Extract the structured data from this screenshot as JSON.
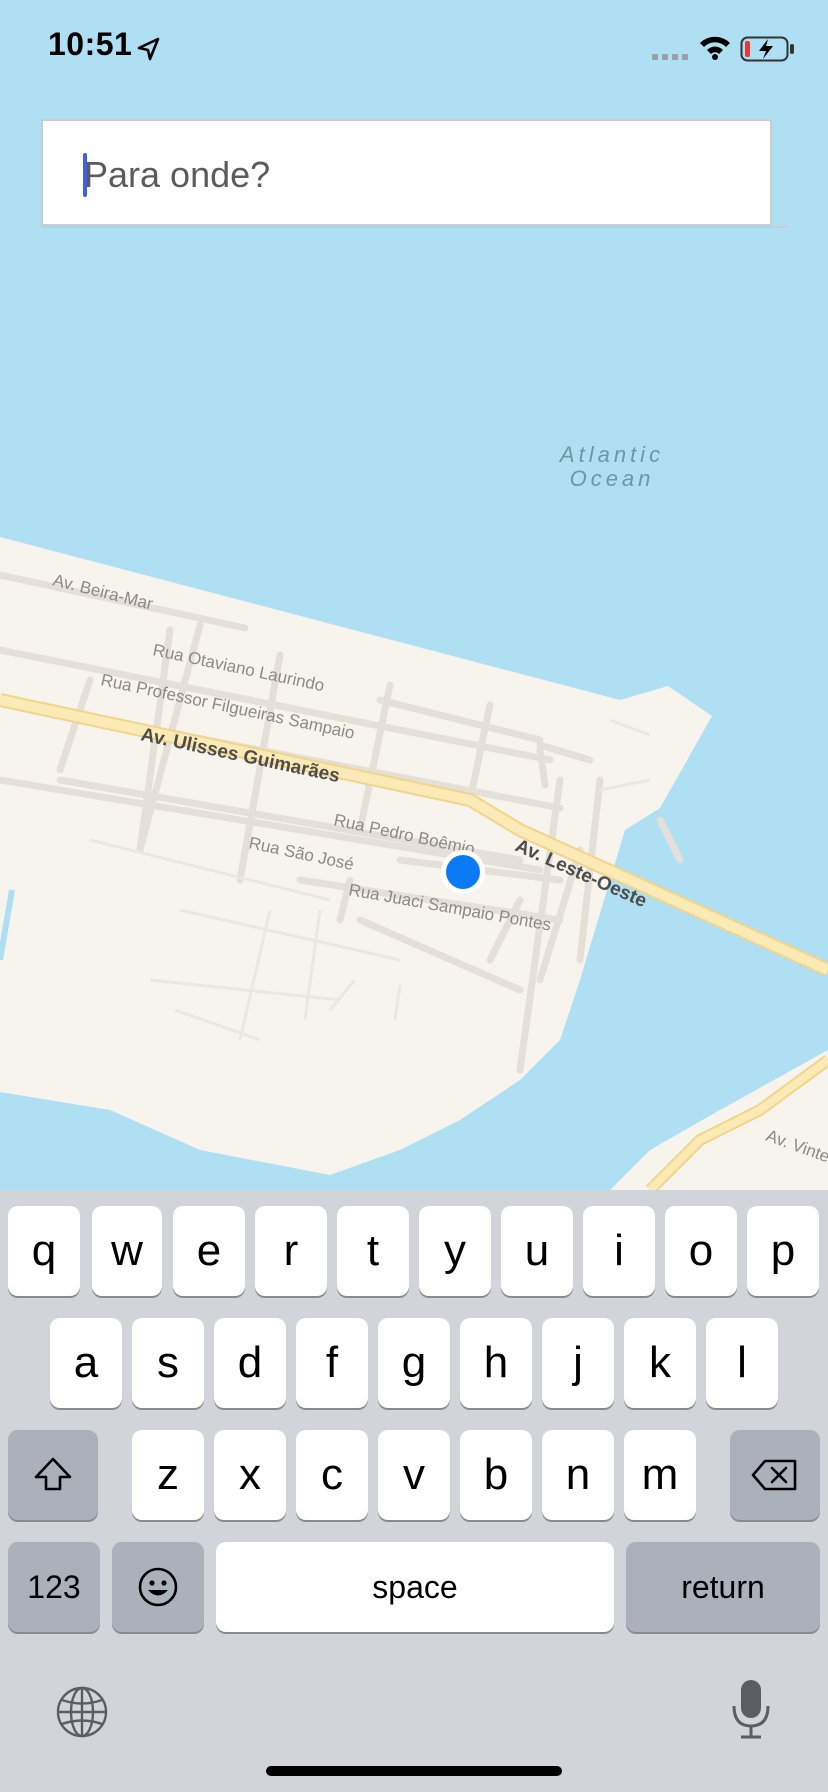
{
  "status_bar": {
    "time": "10:51",
    "icons": [
      "location-arrow-icon",
      "cellular-signal-icon",
      "wifi-icon",
      "battery-charging-icon"
    ]
  },
  "search": {
    "placeholder": "Para onde?",
    "value": ""
  },
  "map": {
    "ocean_label_line1": "Atlantic",
    "ocean_label_line2": "Ocean",
    "streets": {
      "beira_mar": "Av. Beira-Mar",
      "otaviano": "Rua Otaviano Laurindo",
      "filgueiras": "Rua Professor Filgueiras Sampaio",
      "ulisses": "Av. Ulisses Guimarães",
      "pedro": "Rua Pedro Boêmio",
      "sao_jose": "Rua São José",
      "leste_oeste": "Av. Leste-Oeste",
      "juaci": "Rua Juaci Sampaio Pontes",
      "vinte": "Av. Vinte"
    },
    "colors": {
      "water": "#aedff2",
      "land": "#f7f4ee",
      "road": "#e5e1da",
      "highway": "#fbeab5",
      "user_dot": "#0a7bf5"
    }
  },
  "keyboard": {
    "row1": [
      "q",
      "w",
      "e",
      "r",
      "t",
      "y",
      "u",
      "i",
      "o",
      "p"
    ],
    "row2": [
      "a",
      "s",
      "d",
      "f",
      "g",
      "h",
      "j",
      "k",
      "l"
    ],
    "row3": [
      "z",
      "x",
      "c",
      "v",
      "b",
      "n",
      "m"
    ],
    "numbers_label": "123",
    "space_label": "space",
    "return_label": "return",
    "icons": [
      "shift-icon",
      "delete-icon",
      "emoji-icon",
      "globe-icon",
      "microphone-icon"
    ]
  }
}
